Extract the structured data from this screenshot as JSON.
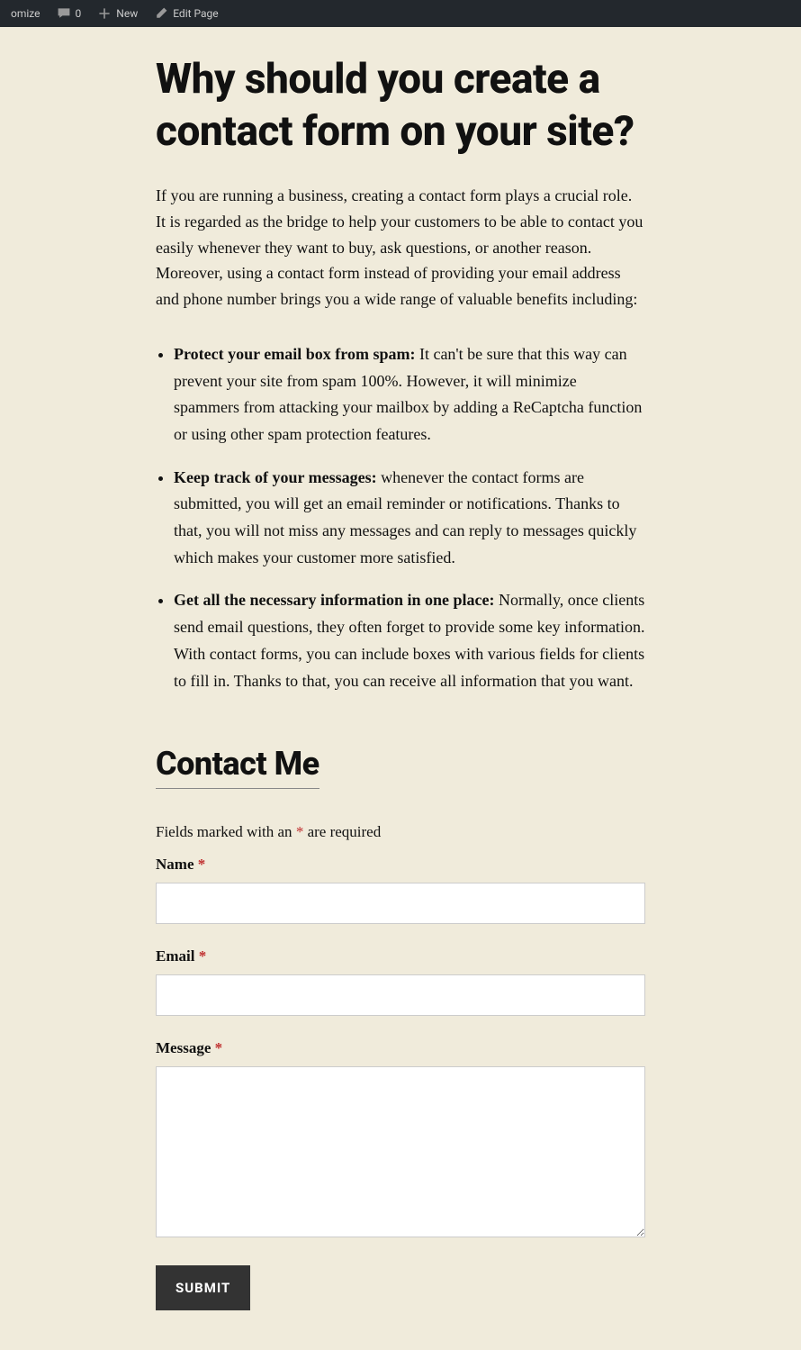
{
  "adminBar": {
    "customize": "omize",
    "commentCount": "0",
    "new": "New",
    "editPage": "Edit Page"
  },
  "article": {
    "heading": "Why should you create a contact form on your site?",
    "intro": "If you are running a business, creating a contact form plays a crucial role. It is regarded as the bridge to help your customers to be able to contact you easily whenever they want to buy, ask questions, or another reason. Moreover, using a contact form instead of providing your email address and phone number brings you a wide range of valuable benefits including:",
    "points": [
      {
        "bold": "Protect your email box from spam:",
        "text": " It can't be sure that this way can prevent your site from spam 100%. However, it will minimize spammers from attacking your mailbox by adding a ReCaptcha function or using other spam protection features."
      },
      {
        "bold": "Keep track of your messages:",
        "text": " whenever the contact forms are submitted, you will get an email reminder or notifications. Thanks to that, you will not miss any messages and can reply to messages quickly which makes your customer more satisfied."
      },
      {
        "bold": "Get all the necessary information in one place:",
        "text": " Normally, once clients send email questions, they often forget to provide some key information. With contact forms, you can include boxes with various fields for clients to fill in. Thanks to that, you can receive all information that you want."
      }
    ]
  },
  "form": {
    "title": "Contact Me",
    "requiredNotePrefix": "Fields marked with an ",
    "requiredNoteAsterisk": "*",
    "requiredNoteSuffix": " are required",
    "fields": {
      "name": "Name ",
      "email": "Email ",
      "message": "Message "
    },
    "asterisk": "*",
    "submit": "SUBMIT"
  }
}
